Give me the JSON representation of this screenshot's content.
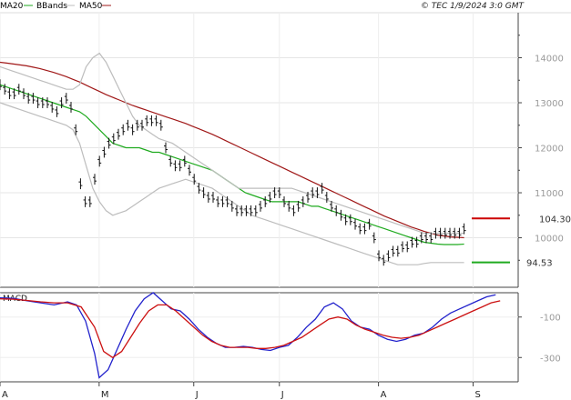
{
  "header": {
    "source": "© TEC 1/9/2024 3:0 GMT",
    "legend": [
      {
        "label": "MA20",
        "color": "#1faa1f"
      },
      {
        "label": "BBands",
        "color": "#bdbdbd"
      },
      {
        "label": "MA50",
        "color": "#a01818"
      }
    ]
  },
  "chart_data": [
    {
      "type": "line",
      "panel": "price",
      "ylim": [
        89,
        150
      ],
      "yticks": [
        100,
        110,
        120,
        130,
        140
      ],
      "ytick_labels": [
        "10000",
        "11000",
        "12000",
        "13000",
        "14000"
      ],
      "x_labels": [
        {
          "label": "A",
          "x": 0
        },
        {
          "label": "M",
          "x": 22
        },
        {
          "label": "J",
          "x": 43
        },
        {
          "label": "J",
          "x": 62
        },
        {
          "label": "A",
          "x": 84
        },
        {
          "label": "S",
          "x": 105
        }
      ],
      "xlim": [
        0,
        115
      ],
      "grid": true,
      "series": [
        {
          "name": "Price",
          "kind": "ohlc-bars",
          "color": "#111111",
          "values": [
            134,
            133,
            132,
            132,
            133,
            132,
            131,
            131,
            130,
            130,
            130,
            129,
            128,
            130,
            131,
            129,
            124,
            112,
            108,
            108,
            113,
            117,
            119,
            121,
            122,
            123,
            124,
            125,
            124,
            125,
            125,
            126,
            126,
            126,
            125,
            120,
            117,
            116,
            116,
            117,
            115,
            113,
            111,
            110,
            109,
            109,
            108,
            108,
            108,
            107,
            106,
            106,
            106,
            106,
            106,
            107,
            108,
            109,
            110,
            110,
            108,
            107,
            106,
            107,
            108,
            109,
            110,
            110,
            111,
            109,
            107,
            106,
            105,
            104,
            104,
            103,
            102,
            102,
            103,
            100,
            96,
            95,
            96,
            97,
            97,
            98,
            98,
            99,
            99,
            100,
            100,
            100,
            101,
            101,
            101,
            101,
            101,
            101,
            102
          ]
        },
        {
          "name": "MA20",
          "kind": "line",
          "color": "#1faa1f",
          "values": [
            134,
            133.5,
            133,
            132.5,
            132,
            131.5,
            131,
            130.5,
            130,
            129.5,
            129,
            128.5,
            128,
            127,
            125.5,
            124,
            122.5,
            121,
            120.5,
            120,
            120,
            120,
            119.5,
            119,
            119,
            118.5,
            118,
            117.5,
            117,
            116.5,
            116,
            115.5,
            115,
            114,
            113,
            112,
            111,
            110,
            109.5,
            109,
            108.5,
            108,
            108,
            108,
            108,
            108,
            107.5,
            107,
            107,
            106.5,
            106,
            105.5,
            105,
            104.5,
            104,
            103.5,
            103,
            102.5,
            102,
            101.5,
            101,
            100.5,
            100,
            99.5,
            99,
            98.8,
            98.6,
            98.5,
            98.5,
            98.5,
            98.6
          ]
        },
        {
          "name": "MA50",
          "kind": "line",
          "color": "#a01818",
          "values": [
            139,
            138.8,
            138.6,
            138.4,
            138.2,
            137.9,
            137.6,
            137.2,
            136.8,
            136.3,
            135.8,
            135.2,
            134.6,
            133.9,
            133.2,
            132.5,
            131.8,
            131.2,
            130.6,
            130,
            129.4,
            128.9,
            128.4,
            127.9,
            127.4,
            126.9,
            126.4,
            125.9,
            125.4,
            124.8,
            124.2,
            123.6,
            123,
            122.3,
            121.6,
            120.9,
            120.2,
            119.5,
            118.8,
            118.1,
            117.4,
            116.7,
            116,
            115.3,
            114.6,
            113.9,
            113.2,
            112.5,
            111.8,
            111.1,
            110.4,
            109.7,
            109,
            108.3,
            107.6,
            106.9,
            106.2,
            105.5,
            104.8,
            104.2,
            103.6,
            103,
            102.4,
            101.9,
            101.4,
            101,
            100.6,
            100.4,
            100.2,
            100.1,
            100
          ]
        },
        {
          "name": "BBands upper",
          "kind": "line",
          "color": "#bdbdbd",
          "values": [
            138,
            137.5,
            137,
            136.5,
            136,
            135.5,
            135,
            134.5,
            134,
            133.5,
            133,
            133,
            134,
            138,
            140,
            141,
            139,
            136,
            133,
            130,
            127,
            125,
            124,
            123,
            122,
            121.5,
            121,
            120,
            119,
            118,
            117,
            116,
            115,
            114,
            113,
            112,
            111,
            111,
            111,
            111,
            111,
            111,
            111,
            111,
            111,
            110.5,
            110,
            109.5,
            109,
            108.5,
            108,
            107.5,
            107,
            106.5,
            106,
            105.5,
            105,
            104.5,
            104,
            103.5,
            103,
            102.5,
            102,
            101.5,
            101,
            101,
            101,
            101,
            101,
            101,
            101
          ]
        },
        {
          "name": "BBands lower",
          "kind": "line",
          "color": "#bdbdbd",
          "values": [
            130,
            129.5,
            129,
            128.5,
            128,
            127.5,
            127,
            126.5,
            126,
            125.5,
            125,
            124,
            121,
            116,
            111,
            108,
            106,
            105,
            105.5,
            106,
            107,
            108,
            109,
            110,
            111,
            111.5,
            112,
            112.5,
            113,
            112.5,
            112,
            111.5,
            111,
            110,
            109,
            108,
            107,
            106,
            105,
            104.5,
            104,
            103.5,
            103,
            102.5,
            102,
            101.5,
            101,
            100.5,
            100,
            99.5,
            99,
            98.5,
            98,
            97.5,
            97,
            96.5,
            96,
            95.5,
            95,
            94.5,
            94,
            94,
            94,
            94,
            94.3,
            94.5,
            94.5,
            94.5,
            94.5,
            94.5,
            94.5
          ]
        }
      ],
      "markers": [
        {
          "label": "104.30",
          "value": 104.3,
          "color": "#cc0000"
        },
        {
          "label": "94.53",
          "value": 94.53,
          "color": "#1faa1f"
        }
      ]
    },
    {
      "type": "line",
      "panel": "MACD",
      "title": "MACD",
      "ylim": [
        -420,
        20
      ],
      "yticks": [
        -100,
        -300
      ],
      "ytick_labels": [
        "-100",
        "-300"
      ],
      "xlim": [
        0,
        115
      ],
      "series": [
        {
          "name": "MACD",
          "color": "#2222cc",
          "x": [
            0,
            3,
            6,
            9,
            12,
            15,
            17,
            19,
            21,
            22,
            24,
            26,
            28,
            30,
            32,
            34,
            36,
            38,
            40,
            42,
            44,
            46,
            48,
            50,
            52,
            54,
            56,
            58,
            60,
            62,
            64,
            66,
            68,
            70,
            72,
            74,
            76,
            78,
            80,
            82,
            84,
            86,
            88,
            90,
            92,
            94,
            96,
            98,
            100,
            102,
            104,
            106,
            108,
            110
          ],
          "values": [
            -5,
            -8,
            -20,
            -30,
            -40,
            -25,
            -40,
            -120,
            -280,
            -400,
            -360,
            -260,
            -160,
            -70,
            -10,
            20,
            -20,
            -60,
            -70,
            -110,
            -160,
            -200,
            -230,
            -250,
            -250,
            -245,
            -250,
            -260,
            -265,
            -250,
            -240,
            -200,
            -150,
            -110,
            -50,
            -30,
            -60,
            -120,
            -150,
            -160,
            -190,
            -210,
            -220,
            -210,
            -190,
            -180,
            -150,
            -110,
            -80,
            -60,
            -40,
            -20,
            0,
            10
          ]
        },
        {
          "name": "Signal",
          "color": "#cc1111",
          "x": [
            0,
            3,
            6,
            9,
            12,
            15,
            18,
            21,
            23,
            25,
            27,
            29,
            31,
            33,
            35,
            37,
            39,
            41,
            43,
            45,
            47,
            49,
            51,
            53,
            55,
            57,
            59,
            61,
            63,
            65,
            67,
            69,
            71,
            73,
            75,
            77,
            79,
            81,
            83,
            85,
            87,
            89,
            91,
            93,
            95,
            97,
            99,
            101,
            103,
            105,
            107,
            109,
            111
          ],
          "values": [
            -10,
            -12,
            -18,
            -25,
            -30,
            -30,
            -50,
            -150,
            -270,
            -300,
            -270,
            -200,
            -130,
            -70,
            -40,
            -40,
            -70,
            -110,
            -150,
            -190,
            -220,
            -240,
            -250,
            -250,
            -250,
            -255,
            -255,
            -250,
            -240,
            -220,
            -200,
            -170,
            -140,
            -110,
            -100,
            -110,
            -140,
            -160,
            -175,
            -190,
            -200,
            -205,
            -200,
            -190,
            -170,
            -150,
            -130,
            -110,
            -90,
            -70,
            -50,
            -30,
            -20
          ]
        }
      ]
    }
  ]
}
